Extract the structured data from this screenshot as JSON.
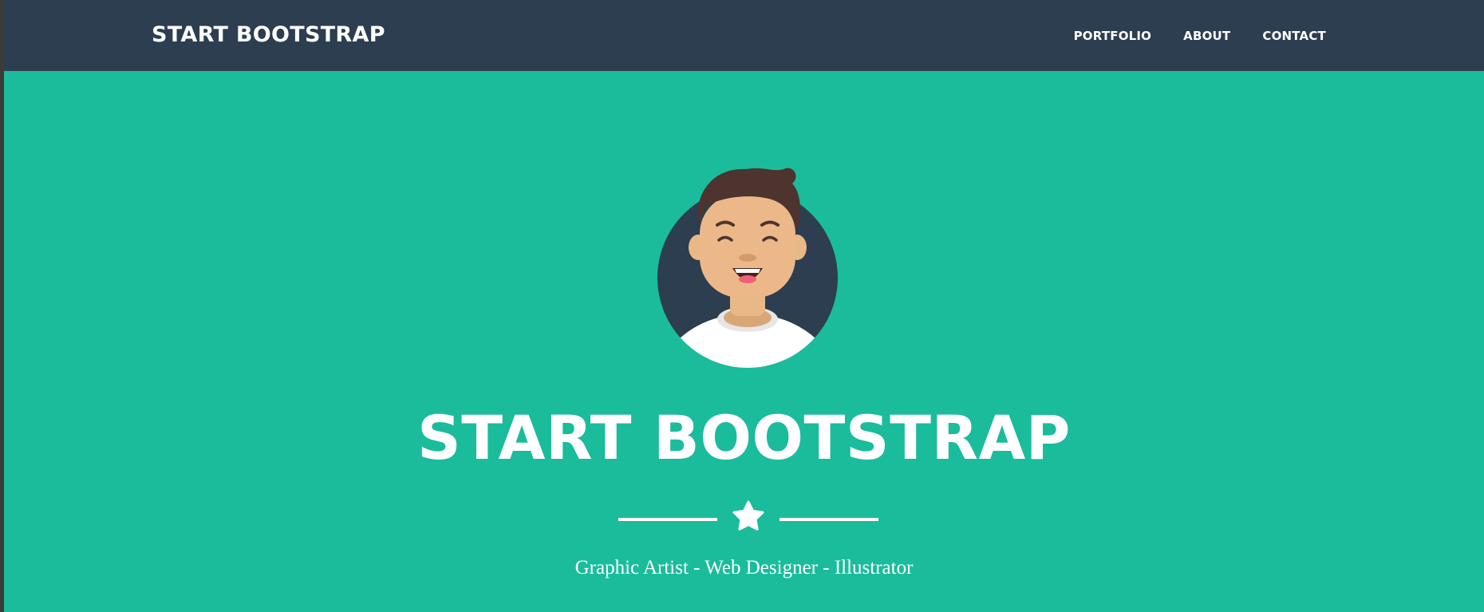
{
  "navbar": {
    "brand": "START BOOTSTRAP",
    "links": [
      {
        "label": "PORTFOLIO"
      },
      {
        "label": "ABOUT"
      },
      {
        "label": "CONTACT"
      }
    ]
  },
  "hero": {
    "avatar_icon": "smiling-man-avatar",
    "title": "START BOOTSTRAP",
    "divider_icon": "star-icon",
    "subtitle": "Graphic Artist - Web Designer - Illustrator"
  },
  "colors": {
    "navbar_bg": "#2c3e50",
    "hero_bg": "#1abc9c",
    "text": "#ffffff"
  }
}
